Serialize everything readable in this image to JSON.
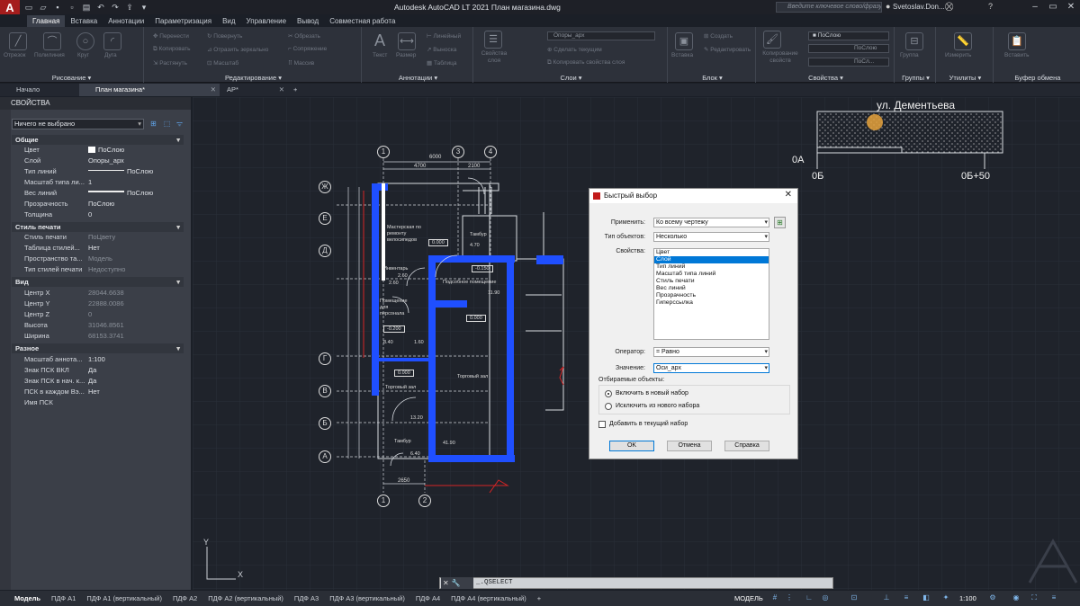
{
  "titlebar": {
    "app_logo": "A",
    "title": "Autodesk AutoCAD LT 2021   План магазина.dwg",
    "search_placeholder": "Введите ключевое слово/фразу",
    "user": "Svetoslav.Don...",
    "help": "?"
  },
  "ribbon_tabs": [
    "Главная",
    "Вставка",
    "Аннотации",
    "Параметризация",
    "Вид",
    "Управление",
    "Вывод",
    "Совместная работа"
  ],
  "ribbon_groups": {
    "draw": {
      "label": "Рисование ▾",
      "items": [
        "Отрезок",
        "Полилиния",
        "Круг",
        "Дуга"
      ]
    },
    "modify": {
      "label": "Редактирование ▾",
      "items": [
        "Перенести",
        "Повернуть",
        "Обрезать",
        "Копировать",
        "Отразить зеркально",
        "Сопряжение",
        "Растянуть",
        "Масштаб",
        "Массив"
      ]
    },
    "annotation": {
      "label": "Аннотации ▾",
      "items": [
        "Текст",
        "Размер",
        "Линейный",
        "Выноска",
        "Таблица"
      ]
    },
    "layers": {
      "label": "Слои ▾",
      "items": [
        "Свойства слоя",
        "Опоры_арх",
        "Сделать текущим",
        "Копировать свойства слоя"
      ]
    },
    "block": {
      "label": "Блок ▾",
      "items": [
        "Вставка",
        "Создать",
        "Редактировать"
      ]
    },
    "properties": {
      "label": "Свойства ▾",
      "items": [
        "Копирование свойств",
        "ПоСлою",
        "ПоСлою",
        "ПоСл..."
      ]
    },
    "groups": {
      "label": "Группы ▾",
      "items": [
        "Группа"
      ]
    },
    "utilities": {
      "label": "Утилиты ▾",
      "items": [
        "Измерить"
      ]
    },
    "clipboard": {
      "label": "Буфер обмена",
      "items": [
        "Вставить"
      ]
    }
  },
  "doc_tabs": [
    {
      "label": "Начало",
      "closable": false
    },
    {
      "label": "План магазина*",
      "closable": true
    },
    {
      "label": "АР*",
      "closable": true
    }
  ],
  "properties_palette": {
    "title": "СВОЙСТВА",
    "selection": "Ничего не выбрано",
    "sections": [
      {
        "name": "Общие",
        "rows": [
          {
            "key": "Цвет",
            "value": "ПоСлою",
            "swatch": "#ffffff"
          },
          {
            "key": "Слой",
            "value": "Опоры_арх"
          },
          {
            "key": "Тип линий",
            "value": "ПоСлою",
            "line": true
          },
          {
            "key": "Масштаб типа ли...",
            "value": "1"
          },
          {
            "key": "Вес линий",
            "value": "ПоСлою",
            "line": true
          },
          {
            "key": "Прозрачность",
            "value": "ПоСлою"
          },
          {
            "key": "Толщина",
            "value": "0"
          }
        ]
      },
      {
        "name": "Стиль печати",
        "rows": [
          {
            "key": "Стиль печати",
            "value": "ПоЦвету",
            "dim": true
          },
          {
            "key": "Таблица стилей...",
            "value": "Нет"
          },
          {
            "key": "Пространство та...",
            "value": "Модель",
            "dim": true
          },
          {
            "key": "Тип стилей печати",
            "value": "Недоступно",
            "dim": true
          }
        ]
      },
      {
        "name": "Вид",
        "rows": [
          {
            "key": "Центр X",
            "value": "28044.6638",
            "dim": true
          },
          {
            "key": "Центр Y",
            "value": "22888.0086",
            "dim": true
          },
          {
            "key": "Центр Z",
            "value": "0",
            "dim": true
          },
          {
            "key": "Высота",
            "value": "31046.8561",
            "dim": true
          },
          {
            "key": "Ширина",
            "value": "68153.3741",
            "dim": true
          }
        ]
      },
      {
        "name": "Разное",
        "rows": [
          {
            "key": "Масштаб аннота...",
            "value": "1:100"
          },
          {
            "key": "Знак ПСК ВКЛ",
            "value": "Да"
          },
          {
            "key": "Знак ПСК в нач. к...",
            "value": "Да"
          },
          {
            "key": "ПСК в каждом Вэ...",
            "value": "Нет"
          },
          {
            "key": "Имя ПСК",
            "value": ""
          }
        ]
      }
    ]
  },
  "drawing": {
    "axes_top": [
      "1",
      "3",
      "4"
    ],
    "axes_left": [
      "Ж",
      "Е",
      "Д",
      "Г",
      "В",
      "Б",
      "А"
    ],
    "axes_bottom": [
      "1",
      "2"
    ],
    "dims": [
      "6000",
      "4700",
      "2100",
      "2650"
    ],
    "rooms": [
      "Мастерская по ремонту велосипедов",
      "Тамбур",
      "Инвентарь",
      "Подсобное помещение",
      "Помещение для персонала",
      "Торговый зал",
      "Торговый зал",
      "Тамбур"
    ],
    "areas": [
      "0.000",
      "4.70",
      "2.60",
      "-0.150",
      "2.60",
      "11.90",
      "0.000",
      "-0.200",
      "8.40",
      "1.60",
      "0.000",
      "13.20",
      "6.40",
      "41.90"
    ],
    "street": "ул. Дементьева",
    "axis_marks": [
      "0А",
      "0Б",
      "0Б+50"
    ]
  },
  "dialog": {
    "title": "Быстрый выбор",
    "apply_label": "Применить:",
    "apply_value": "Ко всему чертежу",
    "type_label": "Тип объектов:",
    "type_value": "Несколько",
    "props_label": "Свойства:",
    "properties": [
      "Цвет",
      "Слой",
      "Тип линий",
      "Масштаб типа линий",
      "Стиль печати",
      "Вес линий",
      "Прозрачность",
      "Гиперссылка"
    ],
    "selected_property": "Слой",
    "operator_label": "Оператор:",
    "operator_value": "= Равно",
    "value_label": "Значение:",
    "value_value": "Оси_арх",
    "how_label": "Отбираемые объекты:",
    "include_label": "Включить в новый набор",
    "exclude_label": "Исключить из нового набора",
    "append_label": "Добавить в текущий набор",
    "ok": "OK",
    "cancel": "Отмена",
    "help": "Справка"
  },
  "command_line": "_.QSELECT",
  "layout_tabs": [
    "Модель",
    "ПДФ А1",
    "ПДФ А1 (вертикальный)",
    "ПДФ А2",
    "ПДФ А2 (вертикальный)",
    "ПДФ А3",
    "ПДФ А3 (вертикальный)",
    "ПДФ А4",
    "ПДФ А4 (вертикальный)",
    "+"
  ],
  "status": {
    "mode": "МОДЕЛЬ",
    "scale": "1:100"
  },
  "colors": {
    "accent_blue": "#1f4fff",
    "canvas_bg": "#1f232b",
    "selection_blue": "#0078d7",
    "logo_red": "#a51d1d"
  }
}
